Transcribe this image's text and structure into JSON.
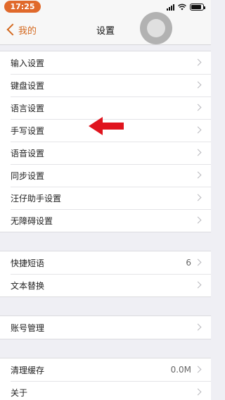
{
  "status_bar": {
    "time": "17:25",
    "time_pill_color": "#e0692b",
    "battery_level": 0.9,
    "icons": [
      "signal-icon",
      "wifi-icon",
      "battery-icon"
    ]
  },
  "nav": {
    "back_label": "我的",
    "title": "设置",
    "accent_color": "#d4691f"
  },
  "groups": [
    {
      "items": [
        {
          "label": "输入设置"
        },
        {
          "label": "键盘设置"
        },
        {
          "label": "语言设置"
        },
        {
          "label": "手写设置"
        },
        {
          "label": "语音设置"
        },
        {
          "label": "同步设置"
        },
        {
          "label": "汪仔助手设置"
        },
        {
          "label": "无障碍设置"
        }
      ]
    },
    {
      "items": [
        {
          "label": "快捷短语",
          "value": "6"
        },
        {
          "label": "文本替换"
        }
      ]
    },
    {
      "items": [
        {
          "label": "账号管理"
        }
      ]
    },
    {
      "items": [
        {
          "label": "清理缓存",
          "value": "0.0M"
        },
        {
          "label": "关于"
        }
      ]
    }
  ],
  "annotation": {
    "arrow_color": "#e0141e",
    "points_to": "手写设置"
  }
}
